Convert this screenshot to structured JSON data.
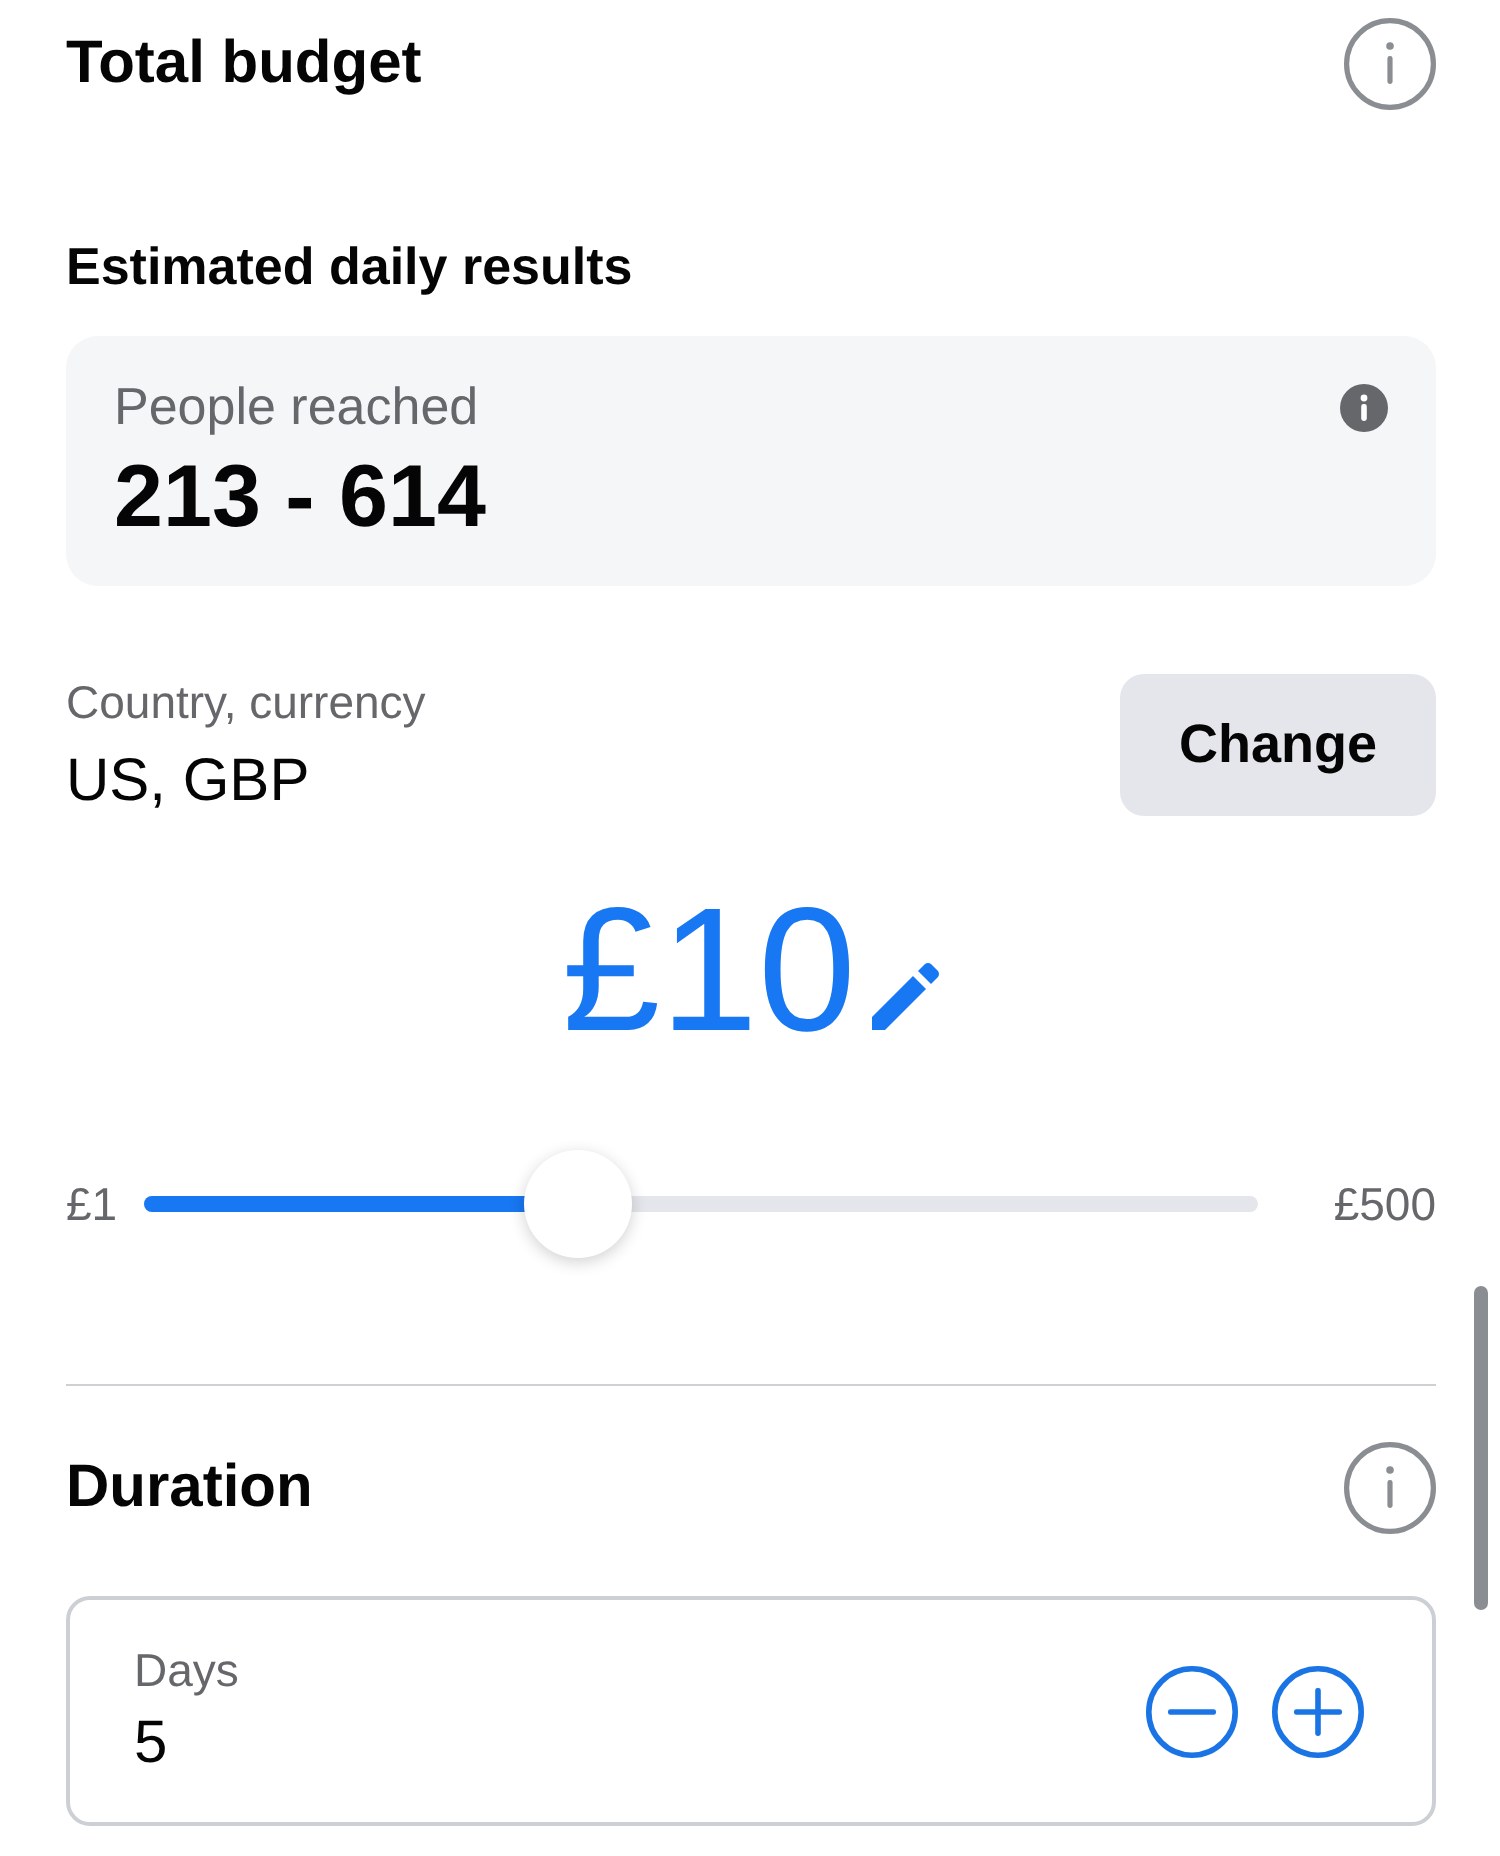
{
  "budget": {
    "title": "Total budget"
  },
  "estimated_results": {
    "title": "Estimated daily results",
    "metric": {
      "label": "People reached",
      "value": "213 - 614"
    }
  },
  "country_currency": {
    "label": "Country, currency",
    "value": "US, GBP",
    "button": "Change"
  },
  "amount": {
    "value": "£10"
  },
  "budget_slider": {
    "min_label": "£1",
    "max_label": "£500",
    "level": 0.39
  },
  "duration": {
    "title": "Duration",
    "field": {
      "label": "Days",
      "value": "5"
    }
  }
}
